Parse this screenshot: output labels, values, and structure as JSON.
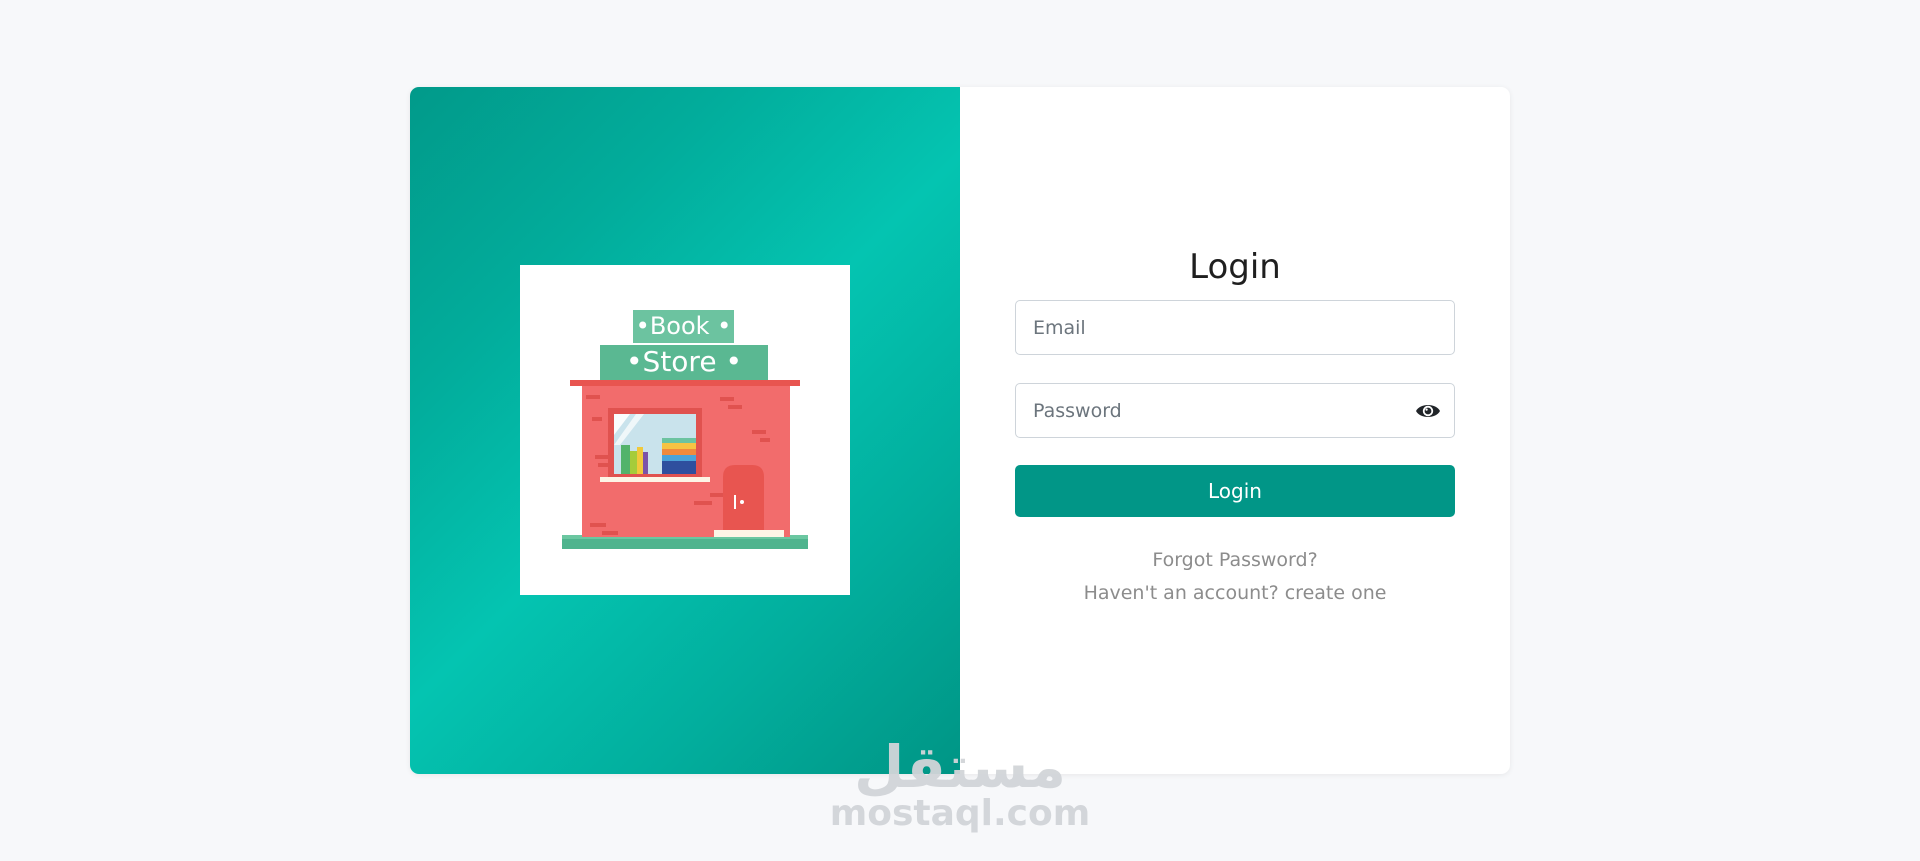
{
  "illustration": {
    "sign_top": "•Book •",
    "sign_bottom": "•Store •"
  },
  "form": {
    "title": "Login",
    "email_placeholder": "Email",
    "password_placeholder": "Password",
    "toggle_icon": "eye-icon",
    "submit_label": "Login",
    "forgot_link": "Forgot Password?",
    "create_link": "Haven't an account? create one"
  },
  "watermark": {
    "logo_text": "مستقل",
    "domain": "mostaql.com"
  },
  "colors": {
    "accent": "#019687",
    "gradient_light": "#04c4b1",
    "gradient_dark": "#009585",
    "page_background": "#f7f8fa"
  }
}
